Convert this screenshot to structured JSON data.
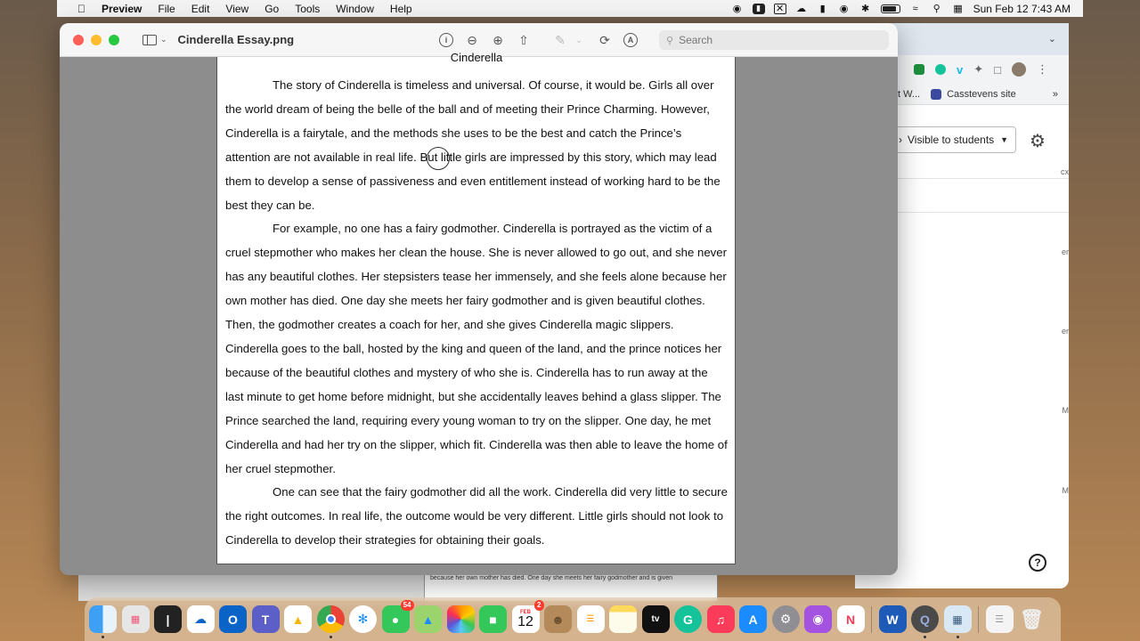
{
  "menubar": {
    "app": "Preview",
    "items": [
      "File",
      "Edit",
      "View",
      "Go",
      "Tools",
      "Window",
      "Help"
    ],
    "datetime": "Sun Feb 12  7:43 AM"
  },
  "window": {
    "title": "Cinderella Essay.png",
    "search_placeholder": "Search"
  },
  "document": {
    "heading": "Cinderella",
    "paragraphs": [
      "The story of Cinderella is timeless and universal. Of course, it would be. Girls all over the world dream of being the belle of the ball and of meeting their Prince Charming. However, Cinderella is a fairytale, and the methods she uses to be the best and catch the Prince’s attention are not available in real life. But little girls are impressed by this story, which may lead them to develop a sense of passiveness and even entitlement instead of working hard to be the best they can be.",
      "For example, no one has a fairy godmother. Cinderella is portrayed as the victim of a cruel stepmother who makes her clean the house. She is never allowed to go out, and she never has any beautiful clothes. Her stepsisters tease her immensely, and she feels alone because her own mother has died. One day she meets her fairy godmother and is given beautiful clothes. Then, the godmother creates a coach for her, and she gives Cinderella magic slippers. Cinderella goes to the ball, hosted by the king and queen of the land, and the prince notices her because of the beautiful clothes and mystery of who she is. Cinderella has to run away at the last minute to get home before midnight, but she accidentally leaves behind a glass slipper. The Prince searched the land, requiring every young woman to try on the slipper. One day, he met Cinderella and had her try on the slipper, which fit. Cinderella was then able to leave the home of her cruel stepmother.",
      "One can see that the fairy godmother did all the work. Cinderella did very little to secure the right outcomes. In real life, the outcome would be very different. Little girls should not look to Cinderella to develop their strategies for obtaining their goals."
    ],
    "underlying_snippet": "because her own mother has died. One day she meets her fairy godmother and is given"
  },
  "chrome": {
    "bookmark_partial": "t W...",
    "bookmark_site": "Casstevens site",
    "visibility_label": "Visible to students",
    "side_fragments": [
      "cx",
      "er",
      "er",
      "M",
      "M"
    ]
  },
  "dock": {
    "messages_badge": "54",
    "calendar_month": "FEB",
    "calendar_day": "12",
    "calendar_badge": "2",
    "appletv_label": "tv",
    "word_label": "W"
  },
  "colors": {
    "traffic_red": "#fe5f57",
    "traffic_yellow": "#febc2e",
    "traffic_green": "#28c840",
    "badge_red": "#ff3b30"
  }
}
